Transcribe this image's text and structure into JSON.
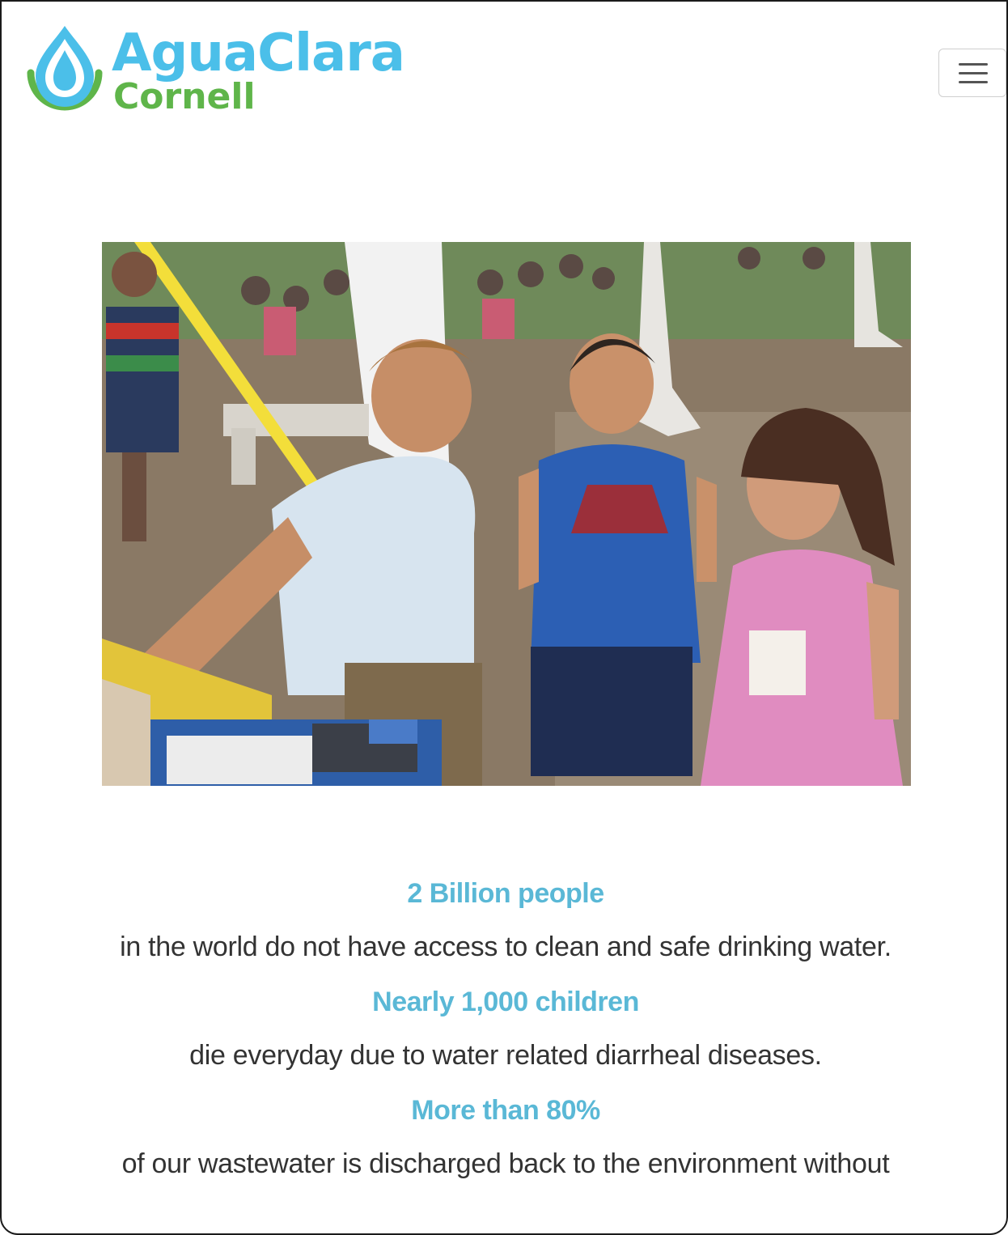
{
  "header": {
    "logo_line_1": "AguaClara",
    "logo_line_2": "Cornell",
    "menu_icon": "hamburger-menu-icon"
  },
  "hero": {
    "description_icon": "photo"
  },
  "stats": [
    {
      "heading": "2 Billion people",
      "text": "in the world do not have access to clean and safe drinking water."
    },
    {
      "heading": "Nearly 1,000 children",
      "text": "die everyday due to water related diarrheal diseases."
    },
    {
      "heading": "More than 80%",
      "text": "of our wastewater is discharged back to the environment without"
    }
  ],
  "colors": {
    "brand_blue": "#4bbfe9",
    "brand_green": "#5fb54a",
    "stat_heading": "#5ab8d6",
    "body_text": "#333333"
  }
}
